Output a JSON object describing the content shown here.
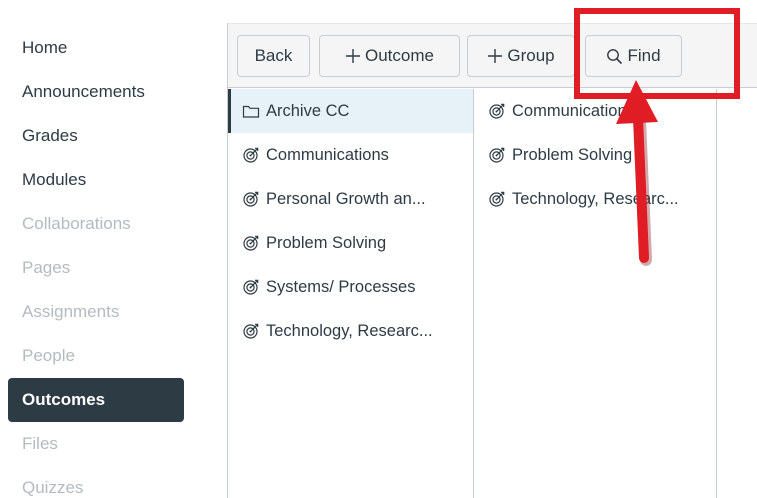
{
  "nav": {
    "items": [
      {
        "label": "Home",
        "state": "enabled"
      },
      {
        "label": "Announcements",
        "state": "enabled"
      },
      {
        "label": "Grades",
        "state": "enabled"
      },
      {
        "label": "Modules",
        "state": "enabled"
      },
      {
        "label": "Collaborations",
        "state": "disabled"
      },
      {
        "label": "Pages",
        "state": "disabled"
      },
      {
        "label": "Assignments",
        "state": "disabled"
      },
      {
        "label": "People",
        "state": "disabled"
      },
      {
        "label": "Outcomes",
        "state": "active"
      },
      {
        "label": "Files",
        "state": "disabled"
      },
      {
        "label": "Quizzes",
        "state": "disabled"
      }
    ]
  },
  "toolbar": {
    "back_label": "Back",
    "outcome_label": "Outcome",
    "group_label": "Group",
    "find_label": "Find"
  },
  "browser": {
    "column1": [
      {
        "label": "Archive CC",
        "icon": "folder-icon",
        "selected": true
      },
      {
        "label": "Communications",
        "icon": "outcome-icon"
      },
      {
        "label": "Personal Growth an...",
        "icon": "outcome-icon"
      },
      {
        "label": "Problem Solving",
        "icon": "outcome-icon"
      },
      {
        "label": "Systems/ Processes",
        "icon": "outcome-icon"
      },
      {
        "label": "Technology, Researc...",
        "icon": "outcome-icon"
      }
    ],
    "column2": [
      {
        "label": "Communications",
        "icon": "outcome-icon"
      },
      {
        "label": "Problem Solving",
        "icon": "outcome-icon"
      },
      {
        "label": "Technology, Researc...",
        "icon": "outcome-icon"
      }
    ]
  },
  "colors": {
    "nav_active_bg": "#2d3b45",
    "nav_disabled_text": "#b4bbc0",
    "selected_row_bg": "#e7f1f8",
    "annotation_red": "#e01c24"
  }
}
